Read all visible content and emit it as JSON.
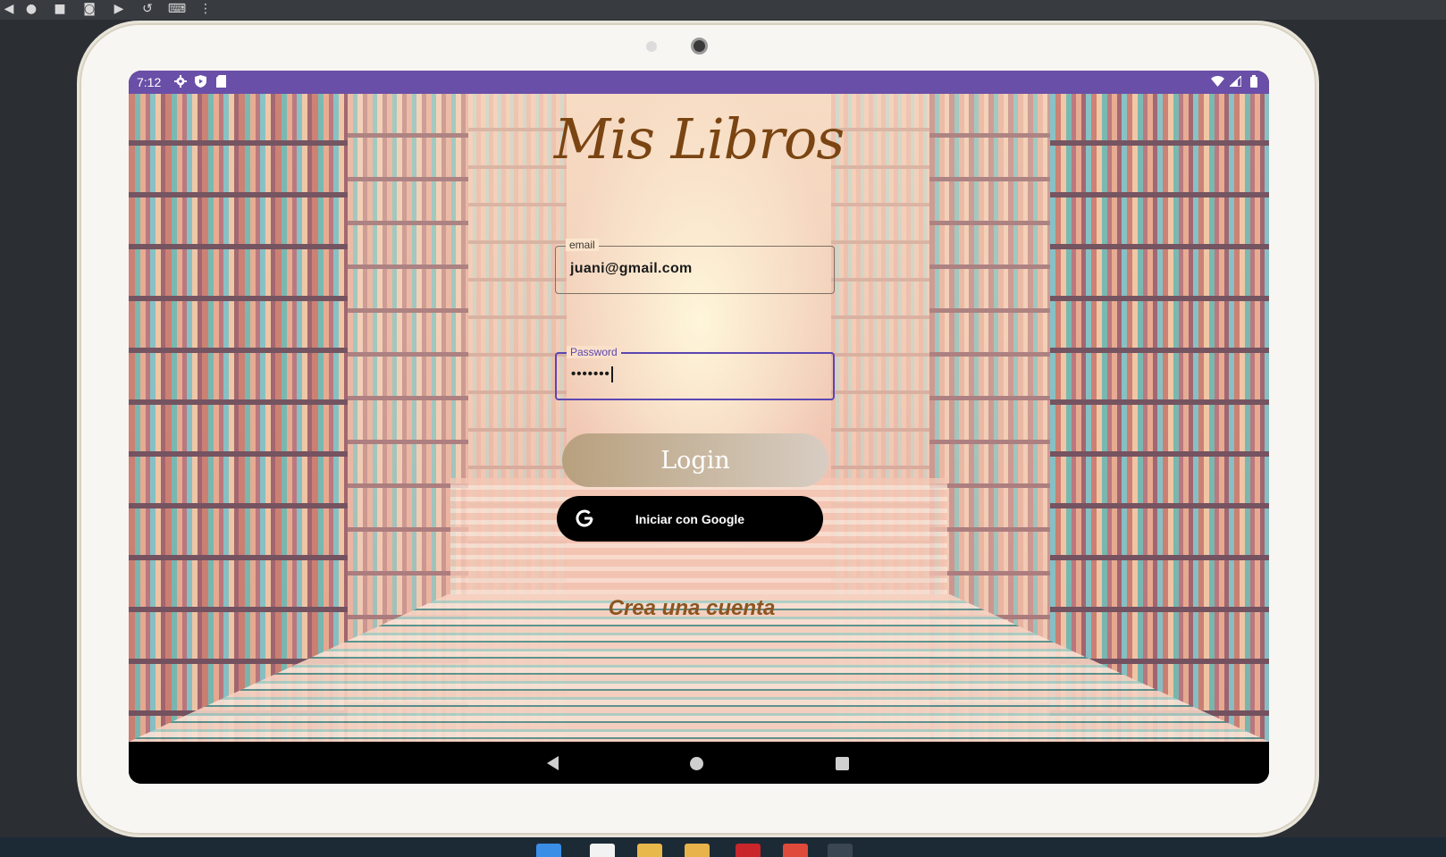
{
  "app": {
    "title": "Mis Libros",
    "email": {
      "label": "email",
      "value": "juani@gmail.com"
    },
    "password": {
      "label": "Password",
      "value": "•••••••"
    },
    "login_label": "Login",
    "google_label": "Iniciar con Google",
    "create_account_label": "Crea una cuenta"
  },
  "status_bar": {
    "time": "7:12"
  },
  "icons": {
    "settings": "gear-icon",
    "play_protect": "shield-icon",
    "sd_card": "sd-card-icon",
    "wifi": "wifi-icon",
    "signal": "signal-icon",
    "battery": "battery-icon",
    "google": "google-g-icon"
  },
  "colors": {
    "status_bar": "#6a4fa8",
    "title": "#7a4512",
    "focus_outline": "#5b46b3",
    "create_account": "#8c5521",
    "google_button": "#000000"
  }
}
